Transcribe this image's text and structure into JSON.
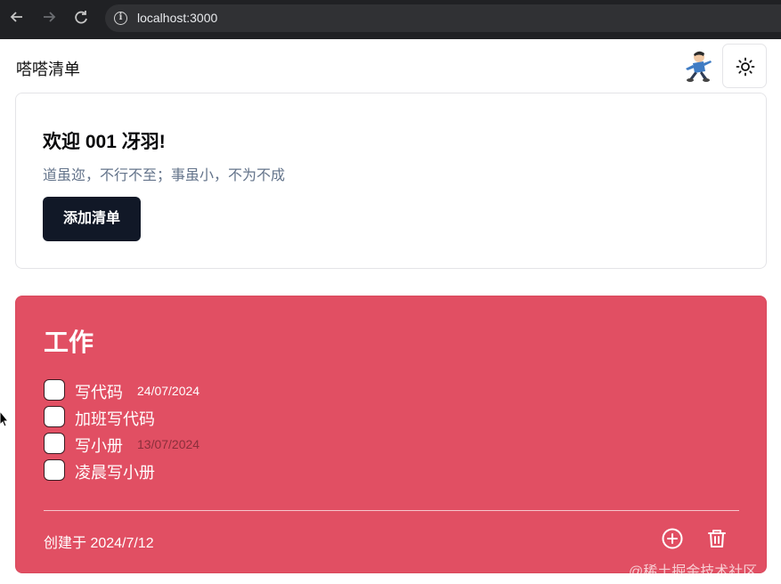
{
  "browser": {
    "url": "localhost:3000",
    "back_icon": "arrow-left-icon",
    "forward_icon": "arrow-right-icon",
    "reload_icon": "reload-icon",
    "info_icon": "info-icon"
  },
  "header": {
    "title": "嗒嗒清单",
    "avatar_icon": "avatar-icon",
    "theme_icon": "sun-icon"
  },
  "welcome": {
    "title": "欢迎 001 冴羽!",
    "motto": "道虽迩，不行不至；事虽小，不为不成",
    "add_button": "添加清单"
  },
  "list": {
    "title": "工作",
    "color": "#e14f63",
    "items": [
      {
        "text": "写代码",
        "date": "24/07/2024",
        "date_color": "#ffffff",
        "checked": false
      },
      {
        "text": "加班写代码",
        "date": "",
        "checked": false
      },
      {
        "text": "写小册",
        "date": "13/07/2024",
        "date_color": "#8a2f3b",
        "checked": false
      },
      {
        "text": "凌晨写小册",
        "date": "",
        "checked": false
      }
    ],
    "created": "创建于 2024/7/12",
    "add_icon": "plus-circle-icon",
    "delete_icon": "trash-icon"
  },
  "watermark": "@稀土掘金技术社区"
}
